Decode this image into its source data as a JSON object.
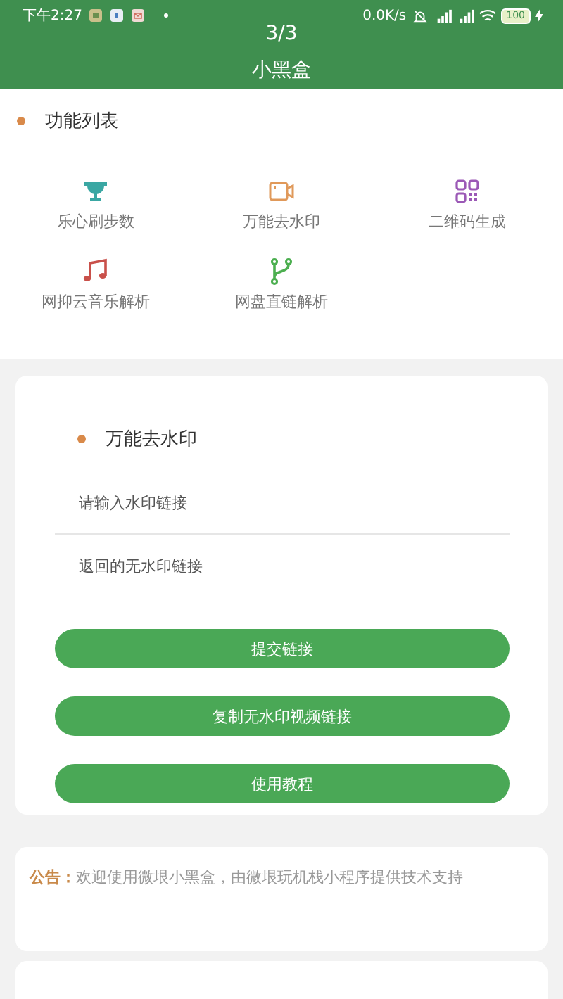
{
  "status_bar": {
    "time": "下午2:27",
    "speed": "0.0K/s",
    "battery": "100"
  },
  "header": {
    "page": "3/3",
    "title": "小黑盒"
  },
  "features": {
    "title": "功能列表",
    "items": [
      {
        "kind": "trophy",
        "label": "乐心刷步数",
        "color": "#3aa7a3"
      },
      {
        "kind": "video",
        "label": "万能去水印",
        "color": "#e0995a"
      },
      {
        "kind": "qr",
        "label": "二维码生成",
        "color": "#9b59b6"
      },
      {
        "kind": "music",
        "label": "网抑云音乐解析",
        "color": "#c9504a"
      },
      {
        "kind": "branch",
        "label": "网盘直链解析",
        "color": "#4caf50"
      }
    ]
  },
  "tool": {
    "title": "万能去水印",
    "input": {
      "placeholder": "请输入水印链接"
    },
    "output": {
      "placeholder": "返回的无水印链接"
    },
    "buttons": [
      "提交链接",
      "复制无水印视频链接",
      "使用教程"
    ]
  },
  "notice": {
    "label": "公告：",
    "text": "欢迎使用微垠小黑盒，由微垠玩机栈小程序提供技术支持"
  }
}
